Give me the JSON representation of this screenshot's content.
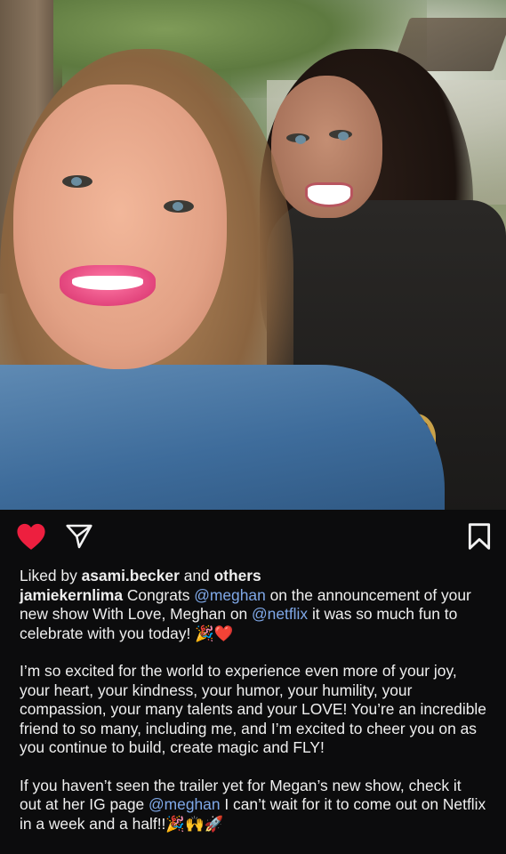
{
  "post": {
    "likes_prefix": "Liked by",
    "likes_user": "asami.becker",
    "likes_and": "and",
    "likes_others": "others",
    "author": "jamiekernlima",
    "caption_p1": [
      " Congrats ",
      "@meghan",
      " on the announcement of your new show With Love, Meghan on ",
      "@netflix",
      " it was so much fun to celebrate with you today! 🎉❤️"
    ],
    "caption_p2": "I’m so excited for the world to experience even more of your joy, your heart, your kindness, your humor, your humility, your compassion, your many talents and your LOVE! You’re an incredible friend to so many, including me, and I’m excited to cheer you on as you continue to build, create magic and FLY!",
    "caption_p3": [
      "If you haven’t seen the trailer yet for Megan’s new show, check it out at her IG page ",
      "@meghan",
      " I can’t wait for it to come out on Netflix in a week and a half!!🎉🙌🚀"
    ]
  },
  "icons": {
    "like": "heart-icon",
    "share": "send-icon",
    "save": "bookmark-icon"
  },
  "colors": {
    "heart": "#ed1f3f",
    "mention": "#7fa8e8",
    "background": "#0c0c0d"
  }
}
